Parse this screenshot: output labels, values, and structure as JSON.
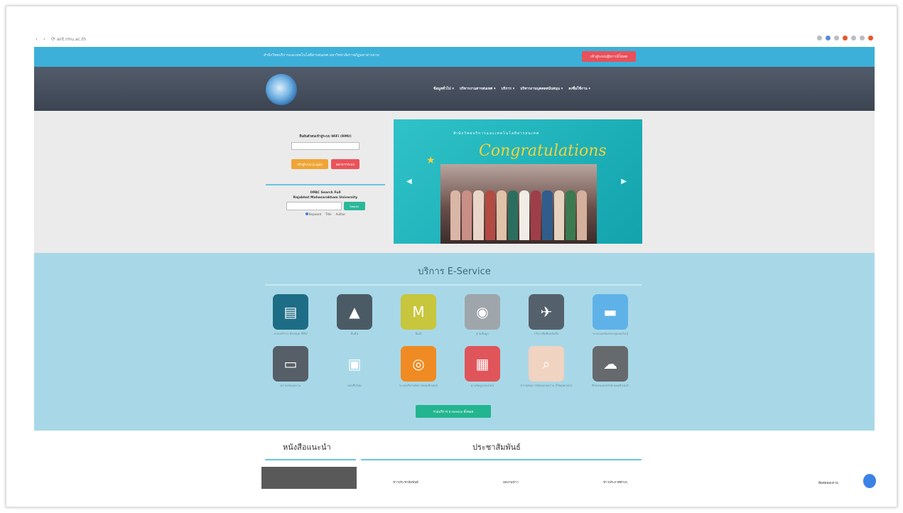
{
  "browser": {
    "nav_glyphs": "‹ › ⟳",
    "url": "arit.rmu.ac.th"
  },
  "topbar": {
    "notice": "สำนักวิทยบริการและเทคโนโลยีสารสนเทศ มหาวิทยาลัยราชภัฏมหาสารคาม",
    "login_button": "เข้าสู่ระบบ@ดาวน์โหลด"
  },
  "nav": {
    "items": [
      "ข้อมูลทั่วไป ▾",
      "บริหารงานสารสนเทศ ▾",
      "บริการ ▾",
      "บริหารงานบุคคลสนับสนุน ▾",
      "ลงชื่อใช้งาน ▾"
    ]
  },
  "hero": {
    "login_label": "ยืนยันตัวตนเข้าสู่ระบบ WiFi (RMU)",
    "btn_login": "เข้าสู่ระบบ (Login)",
    "btn_logout": "ออกจากระบบ",
    "search_title_1": "OPAC Search Full",
    "search_title_2": "Rajabhat Mahasarakham University",
    "search_button": "Search",
    "radio_keyword": "Keyword",
    "radio_title": "Title",
    "radio_author": "Author"
  },
  "banner": {
    "caption": "สำนักวิทยบริการและเทคโนโลยีสารสนเทศ",
    "script": "Congratulations"
  },
  "services": {
    "title": "บริการ E-Service",
    "all_button": "รวมบริการ E-Service ทั้งหมด",
    "tiles": [
      {
        "label": "ระบบบริการ ห้องสมุด RMU",
        "icon": "library-card-icon",
        "color": "#1e6d86",
        "glyph": "▤"
      },
      {
        "label": "ยืมคืน",
        "icon": "bell-icon",
        "color": "#4b5b66",
        "glyph": "▲"
      },
      {
        "label": "อีเมล์",
        "icon": "mail-icon",
        "color": "#c7c63c",
        "glyph": "M"
      },
      {
        "label": "ฐานข้อมูล",
        "icon": "database-icon",
        "color": "#9fa6ab",
        "glyph": "◉"
      },
      {
        "label": "บริการยืมคืนหนังสือ",
        "icon": "delivery-icon",
        "color": "#54616c",
        "glyph": "✈"
      },
      {
        "label": "ระบบจองห้องประชุมออนไลน์",
        "icon": "booking-icon",
        "color": "#5fb2e8",
        "glyph": "▬"
      },
      {
        "label": "ตรวจสอบผลงาน",
        "icon": "calendar-icon",
        "color": "#565e67",
        "glyph": "▭"
      },
      {
        "label": "หนังสือใหม่",
        "icon": "laptop-icon",
        "color": "#a8d8e7",
        "glyph": "▣"
      },
      {
        "label": "ระบบบริหารจัดการคอมพิวเตอร์",
        "icon": "monitor-icon",
        "color": "#ef8b22",
        "glyph": "◎"
      },
      {
        "label": "ฐานข้อมูลออนไลน์",
        "icon": "presentation-icon",
        "color": "#e0555a",
        "glyph": "▦"
      },
      {
        "label": "ตรวจสอบการคัดลอกผลงาน (Plagiarism)",
        "icon": "fingerprint-icon",
        "color": "#f1d3c1",
        "glyph": "⌕"
      },
      {
        "label": "ฝึกอบรมออนไลน์ คอมพิวเตอร์",
        "icon": "cloud-laptop-icon",
        "color": "#666a6d",
        "glyph": "☁"
      }
    ]
  },
  "bottom": {
    "recommended_title": "หนังสือแนะนำ",
    "pr_title": "ประชาสัมพันธ์",
    "tabs": [
      "ข่าวประชาสัมพันธ์",
      "ผลงานข่าว",
      "ข่าวประกาศต่างๆ"
    ]
  },
  "chat": {
    "label": "ติดต่อสอบถาม"
  }
}
